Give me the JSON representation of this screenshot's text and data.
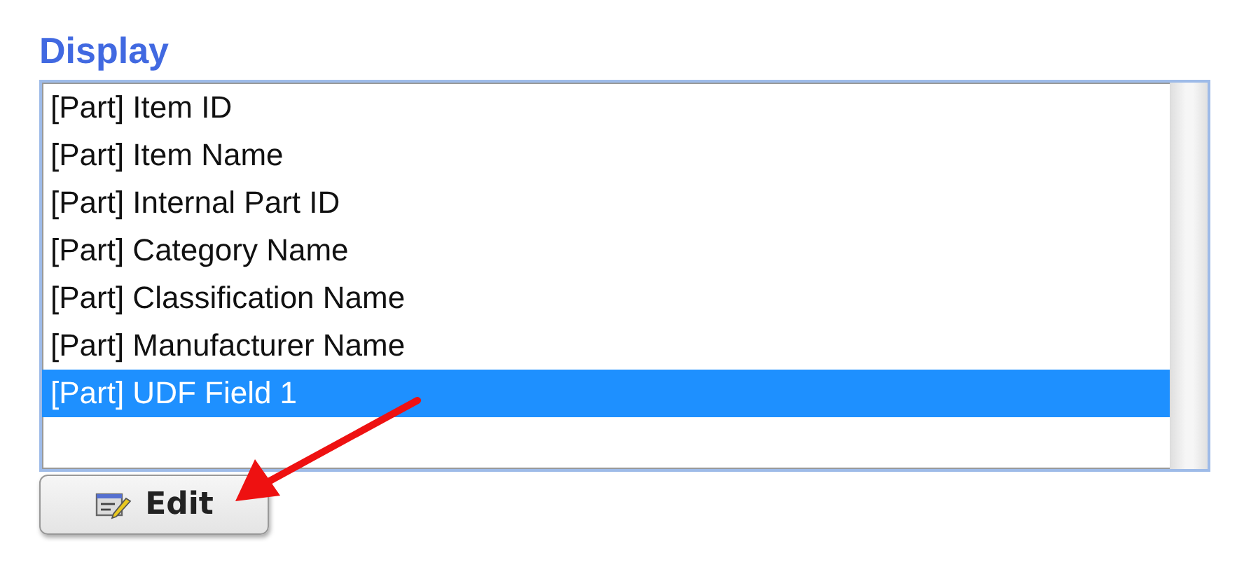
{
  "section": {
    "title": "Display"
  },
  "list": {
    "items": [
      {
        "label": "[Part] Item ID",
        "selected": false
      },
      {
        "label": "[Part] Item Name",
        "selected": false
      },
      {
        "label": "[Part] Internal Part ID",
        "selected": false
      },
      {
        "label": "[Part] Category Name",
        "selected": false
      },
      {
        "label": "[Part] Classification Name",
        "selected": false
      },
      {
        "label": "[Part] Manufacturer Name",
        "selected": false
      },
      {
        "label": "[Part] UDF Field 1",
        "selected": true
      }
    ]
  },
  "buttons": [
    {
      "label": "Edit"
    }
  ]
}
